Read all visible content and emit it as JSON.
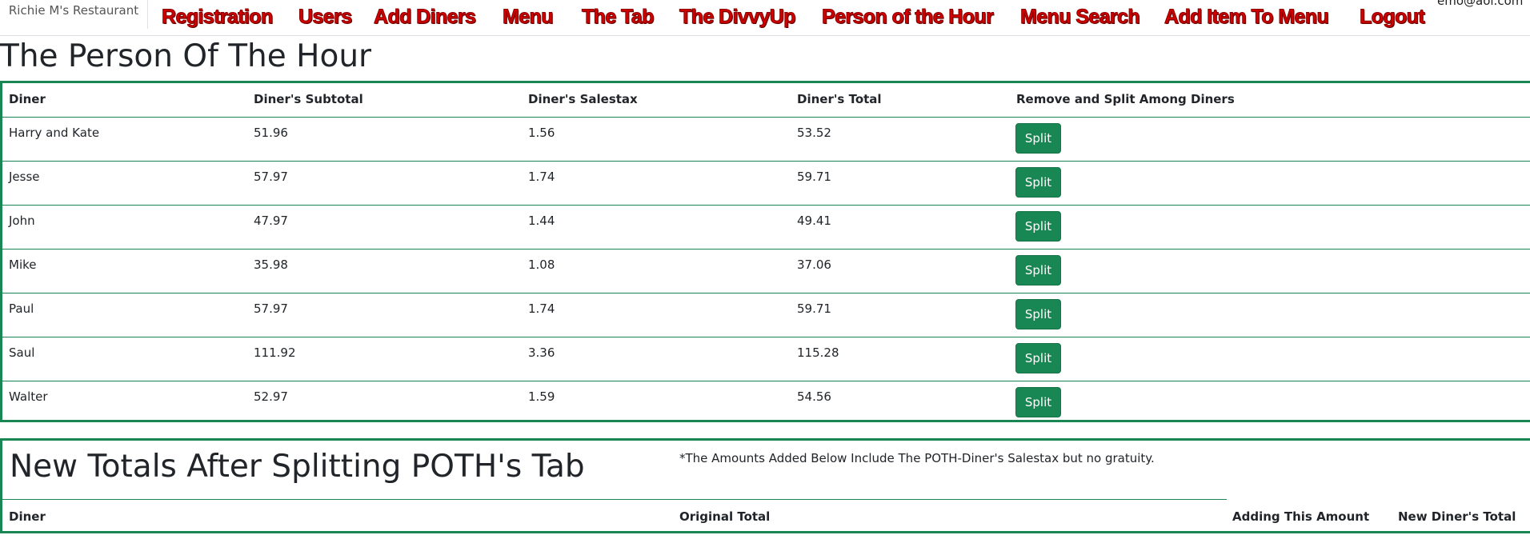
{
  "navbar": {
    "brand": "Richie M's Restaurant",
    "links": [
      "Registration",
      "Users",
      "Add Diners",
      "Menu",
      "The Tab",
      "The DivvyUp",
      "Person of the Hour",
      "Menu Search",
      "Add Item To Menu",
      "Logout"
    ],
    "user_email": "emo@aol.com"
  },
  "page_title": "The Person Of The Hour",
  "poth_table": {
    "headers": [
      "Diner",
      "Diner's Subtotal",
      "Diner's Salestax",
      "Diner's Total",
      "Remove and Split Among Diners"
    ],
    "rows": [
      [
        "Harry and Kate",
        "51.96",
        "1.56",
        "53.52"
      ],
      [
        "Jesse",
        "57.97",
        "1.74",
        "59.71"
      ],
      [
        "John",
        "47.97",
        "1.44",
        "49.41"
      ],
      [
        "Mike",
        "35.98",
        "1.08",
        "37.06"
      ],
      [
        "Paul",
        "57.97",
        "1.74",
        "59.71"
      ],
      [
        "Saul",
        "111.92",
        "3.36",
        "115.28"
      ],
      [
        "Walter",
        "52.97",
        "1.59",
        "54.56"
      ]
    ],
    "button_label": "Split",
    "accent_color": "#198754"
  },
  "new_totals": {
    "title": "New Totals After Splitting POTH's Tab",
    "note": "*The Amounts Added Below Include The POTH-Diner's Salestax but no gratuity.",
    "headers": [
      "Diner",
      "Original Total",
      "Adding This Amount",
      "New Diner's Total"
    ]
  }
}
